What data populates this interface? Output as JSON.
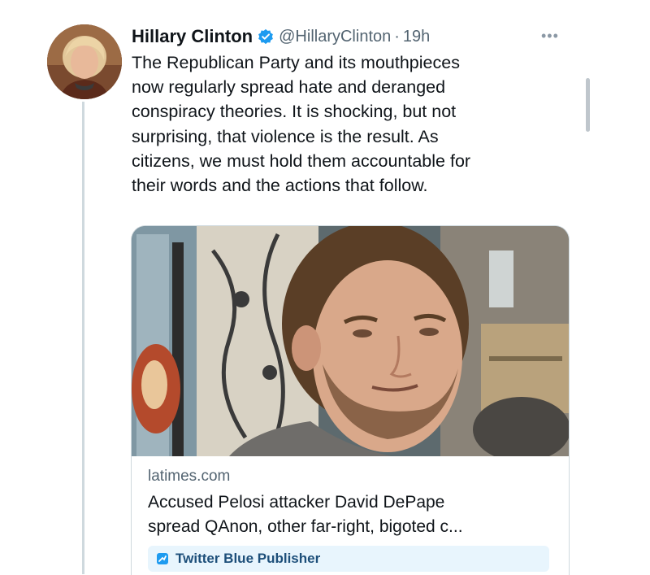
{
  "tweet": {
    "author_name": "Hillary Clinton",
    "handle": "@HillaryClinton",
    "separator": "·",
    "time": "19h",
    "more_icon": "more-options-icon",
    "verified_color": "#1d9bf0",
    "text_lines": [
      "The Republican Party and its mouthpieces",
      "now regularly spread hate and deranged",
      "conspiracy theories. It is shocking, but not",
      "surprising, that violence is the result. As",
      "citizens, we must hold them accountable for",
      "their words and the actions that follow."
    ]
  },
  "card": {
    "domain": "latimes.com",
    "title_lines": [
      "Accused Pelosi attacker David DePape",
      "spread QAnon, other far-right, bigoted c..."
    ],
    "publisher_label": "Twitter Blue Publisher",
    "publisher_icon": "twitter-blue-icon"
  }
}
